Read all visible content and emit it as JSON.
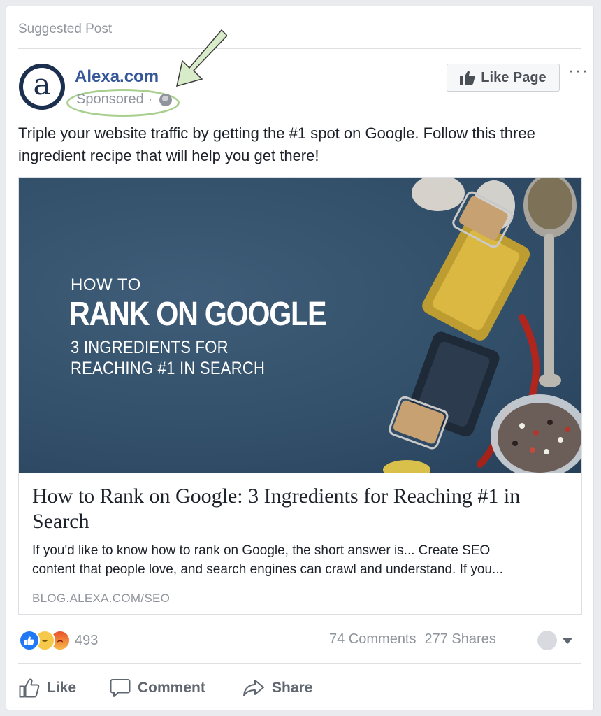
{
  "header": {
    "suggested_label": "Suggested Post"
  },
  "post": {
    "page_name": "Alexa.com",
    "avatar_letter": "a",
    "sponsored_label": "Sponsored",
    "sponsored_separator": "·",
    "like_page_label": "Like Page",
    "more_label": "···",
    "text": "Triple your website traffic by getting the #1 spot on Google. Follow this three ingredient recipe that will help you get there!"
  },
  "link": {
    "image": {
      "line1": "HOW TO",
      "line2": "RANK ON GOOGLE",
      "line3": "3 INGREDIENTS FOR",
      "line4": "REACHING #1 IN SEARCH"
    },
    "title": "How to Rank on Google: 3 Ingredients for Reaching #1 in Search",
    "description_line1": "If you'd like to know how to rank on Google, the short answer is... Create SEO",
    "description_line2": "content that people love, and search engines can crawl and understand. If you...",
    "domain": "BLOG.ALEXA.COM/SEO"
  },
  "stats": {
    "reactions_count": "493",
    "comments": "74 Comments",
    "shares": "277 Shares"
  },
  "actions": {
    "like_label": "Like",
    "comment_label": "Comment",
    "share_label": "Share"
  },
  "colors": {
    "brand_link": "#365899",
    "secondary_text": "#90949c",
    "annotation_green": "#a8cf8e",
    "like_blue": "#2078f4",
    "hero_bg": "#33506a"
  }
}
